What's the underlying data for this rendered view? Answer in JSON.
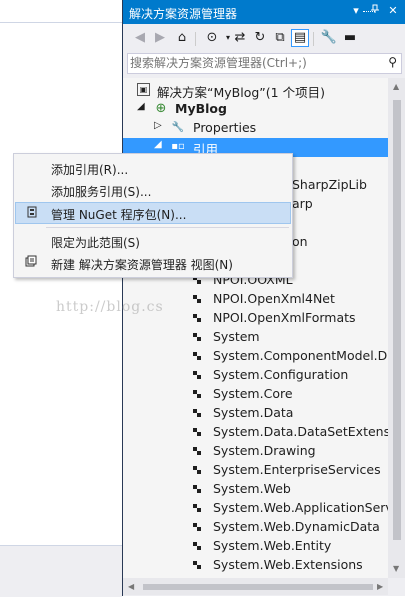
{
  "panel": {
    "title": "解决方案资源管理器",
    "titlebar_buttons": [
      "▾",
      "📌",
      "✕"
    ]
  },
  "search": {
    "placeholder": "搜索解决方案资源管理器(Ctrl+;)"
  },
  "tree": {
    "solution": "解决方案“MyBlog”(1 个项目)",
    "project": "MyBlog",
    "properties": "Properties",
    "references": "引用",
    "partial_rows": [
      {
        "text": "SharpZipLib"
      },
      {
        "text": "arp"
      },
      {
        "text": "on"
      }
    ],
    "refs": [
      "NPOI.OOXML",
      "NPOI.OpenXml4Net",
      "NPOI.OpenXmlFormats",
      "System",
      "System.ComponentModel.Da",
      "System.Configuration",
      "System.Core",
      "System.Data",
      "System.Data.DataSetExtension",
      "System.Drawing",
      "System.EnterpriseServices",
      "System.Web",
      "System.Web.ApplicationServic",
      "System.Web.DynamicData",
      "System.Web.Entity",
      "System.Web.Extensions"
    ]
  },
  "context_menu": {
    "items": [
      {
        "label": "添加引用(R)...",
        "icon": ""
      },
      {
        "label": "添加服务引用(S)...",
        "icon": ""
      },
      {
        "label": "管理 NuGet 程序包(N)...",
        "icon": "nuget-icon"
      },
      {
        "label": "限定为此范围(S)",
        "icon": ""
      },
      {
        "label": "新建 解决方案资源管理器 视图(N)",
        "icon": "new-view-icon"
      }
    ]
  },
  "watermark": "http://blog.cs"
}
